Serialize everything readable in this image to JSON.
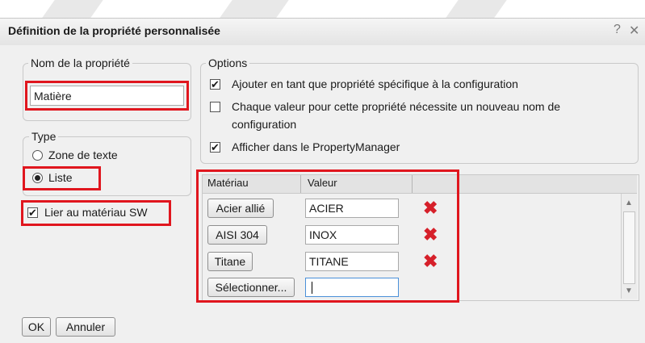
{
  "dialog": {
    "title": "Définition de la propriété personnalisée",
    "help_icon": "?",
    "close_icon": "✕"
  },
  "name_group": {
    "legend": "Nom de la propriété",
    "value": "Matière"
  },
  "type_group": {
    "legend": "Type",
    "options": [
      {
        "label": "Zone de texte",
        "selected": false
      },
      {
        "label": "Liste",
        "selected": true
      }
    ]
  },
  "link_material": {
    "label": "Lier au matériau SW",
    "checked": true
  },
  "options_group": {
    "legend": "Options",
    "items": [
      {
        "label": "Ajouter en tant que propriété spécifique à la configuration",
        "checked": true
      },
      {
        "label": "Chaque valeur pour cette propriété nécessite un nouveau nom de",
        "label2": "configuration",
        "checked": false
      },
      {
        "label": "Afficher dans le PropertyManager",
        "checked": true
      }
    ]
  },
  "grid": {
    "columns": [
      "Matériau",
      "Valeur"
    ],
    "rows": [
      {
        "material": "Acier allié",
        "value": "ACIER",
        "delete_icon": "red-x-icon"
      },
      {
        "material": "AISI 304",
        "value": "INOX",
        "delete_icon": "red-x-icon"
      },
      {
        "material": "Titane",
        "value": "TITANE",
        "delete_icon": "red-x-icon"
      },
      {
        "material": "Sélectionner...",
        "value": ""
      }
    ]
  },
  "footer": {
    "ok": "OK",
    "cancel": "Annuler"
  },
  "colors": {
    "highlight": "#e0161e",
    "delete": "#d6202a",
    "dialog_bg": "#f0f0f0"
  }
}
